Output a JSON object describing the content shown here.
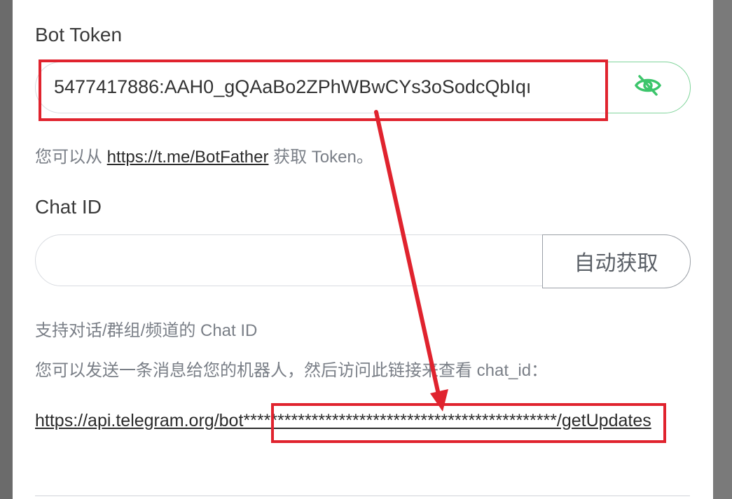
{
  "bot_token": {
    "label": "Bot Token",
    "value": "5477417886:AAH0_gQAaBo2ZPhWBwCYs3oSodcQbIqı",
    "toggle_icon": "eye-slash-icon",
    "help_prefix": "您可以从 ",
    "help_link": "https://t.me/BotFather",
    "help_suffix": " 获取 Token。"
  },
  "chat_id": {
    "label": "Chat ID",
    "value": "",
    "fetch_button": "自动获取",
    "help_line1": "支持对话/群组/频道的 Chat ID",
    "help_line2": "您可以发送一条消息给您的机器人，然后访问此链接来查看 chat_id：",
    "url": "https://api.telegram.org/bot**********************************************/getUpdates"
  },
  "colors": {
    "accent_green": "#3cc56b",
    "annotation_red": "#e0232e"
  }
}
